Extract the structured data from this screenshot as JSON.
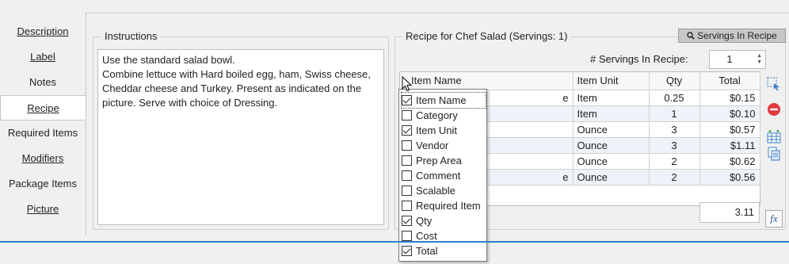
{
  "nav": {
    "items": [
      {
        "label": "Description",
        "link": true
      },
      {
        "label": "Label",
        "link": true
      },
      {
        "label": "Notes",
        "link": false
      },
      {
        "label": "Recipe",
        "link": true,
        "active": true
      },
      {
        "label": "Required Items",
        "link": false
      },
      {
        "label": "Modifiers",
        "link": true
      },
      {
        "label": "Package Items",
        "link": false
      },
      {
        "label": "Picture",
        "link": true
      }
    ]
  },
  "instructions": {
    "title": "Instructions",
    "text": "Use the standard salad bowl.\nCombine lettuce with Hard boiled egg, ham, Swiss cheese, Cheddar cheese and Turkey. Present as indicated on the picture. Serve with choice of Dressing."
  },
  "recipe": {
    "title": "Recipe for Chef Salad (Servings: 1)",
    "servings_button": "Servings In Recipe",
    "servings_label": "# Servings In Recipe:",
    "servings_value": "1",
    "columns": [
      "Item Name",
      "Item Unit",
      "Qty",
      "Total"
    ],
    "rows": [
      {
        "name": "e",
        "unit": "Item",
        "qty": "0.25",
        "total": "$0.15"
      },
      {
        "name": "",
        "unit": "Item",
        "qty": "1",
        "total": "$0.10"
      },
      {
        "name": "",
        "unit": "Ounce",
        "qty": "3",
        "total": "$0.57"
      },
      {
        "name": "",
        "unit": "Ounce",
        "qty": "3",
        "total": "$1.11"
      },
      {
        "name": "",
        "unit": "Ounce",
        "qty": "2",
        "total": "$0.62"
      },
      {
        "name": "e",
        "unit": "Ounce",
        "qty": "2",
        "total": "$0.56"
      }
    ],
    "grand_total": "3.11"
  },
  "column_chooser": {
    "items": [
      {
        "label": "Item Name",
        "checked": true
      },
      {
        "label": "Category",
        "checked": false
      },
      {
        "label": "Item Unit",
        "checked": true
      },
      {
        "label": "Vendor",
        "checked": false
      },
      {
        "label": "Prep Area",
        "checked": false
      },
      {
        "label": "Comment",
        "checked": false
      },
      {
        "label": "Scalable",
        "checked": false
      },
      {
        "label": "Required Item",
        "checked": false
      },
      {
        "label": "Qty",
        "checked": true
      },
      {
        "label": "Cost",
        "checked": false
      },
      {
        "label": "Total",
        "checked": true
      }
    ]
  },
  "icons": {
    "servings": "magnifier-icon",
    "side": [
      "select-cells-icon",
      "remove-icon",
      "insert-row-icon",
      "copy-icon"
    ],
    "formula": "function-icon"
  },
  "colors": {
    "accent": "#2f7bd0",
    "remove": "#e0393e",
    "row_alt": "#eef3f9"
  }
}
